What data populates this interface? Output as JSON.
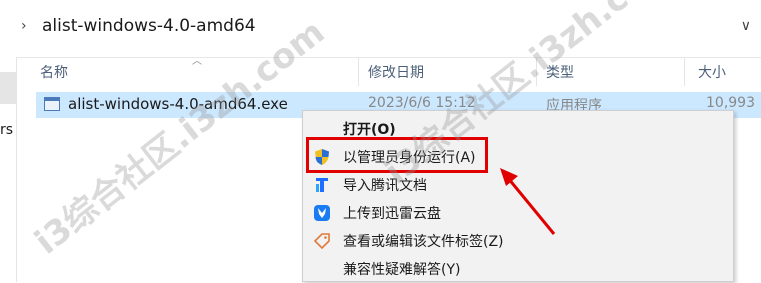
{
  "address_bar": {
    "path": "alist-windows-4.0-amd64",
    "chevron": "›",
    "dropdown": "∨"
  },
  "sidebar": {
    "partial_text": "rs"
  },
  "columns": {
    "name": "名称",
    "modified": "修改日期",
    "type": "类型",
    "size": "大小"
  },
  "file": {
    "name": "alist-windows-4.0-amd64.exe",
    "modified": "2023/6/6 15:12",
    "type": "应用程序",
    "size": "10,993"
  },
  "context_menu": {
    "items": [
      {
        "label": "打开(O)",
        "bold": true,
        "icon": ""
      },
      {
        "label": "以管理员身份运行(A)",
        "bold": false,
        "icon": "uac-shield-icon",
        "highlighted": true
      },
      {
        "label": "导入腾讯文档",
        "bold": false,
        "icon": "tencent-docs-icon"
      },
      {
        "label": "上传到迅雷云盘",
        "bold": false,
        "icon": "xunlei-cloud-icon"
      },
      {
        "label": "查看或编辑该文件标签(Z)",
        "bold": false,
        "icon": "tag-icon"
      },
      {
        "label": "兼容性疑难解答(Y)",
        "bold": false,
        "icon": ""
      }
    ]
  },
  "watermark": "i3综合社区.i3zh.com",
  "colors": {
    "selection": "#cce8ff",
    "highlight_box": "#e00000",
    "arrow": "#e00000",
    "menu_bg": "#f2f2f2"
  }
}
